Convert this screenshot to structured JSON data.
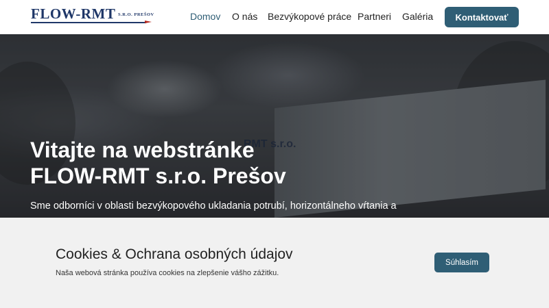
{
  "header": {
    "logo": {
      "name": "FLOW-RMT",
      "suffix": "S.R.O. PREŠOV"
    },
    "nav": [
      {
        "label": "Domov",
        "active": true
      },
      {
        "label": "O nás",
        "active": false
      },
      {
        "label": "Bezvýkopové práce",
        "active": false
      },
      {
        "label": "Partneri",
        "active": false
      },
      {
        "label": "Galéria",
        "active": false
      }
    ],
    "cta_label": "Kontaktovať"
  },
  "hero": {
    "title_line1": "Vitajte na webstránke",
    "title_line2": "FLOW-RMT s.r.o. Prešov",
    "text": "Sme odborníci v oblasti bezvýkopového ukladania potrubí, horizontálneho vŕtania a",
    "truck_label": "RMT s.r.o."
  },
  "cookie": {
    "title": "Cookies & Ochrana osobných údajov",
    "text": "Naša webová stránka používa cookies na zlepšenie vášho zážitku.",
    "accept_label": "Súhlasím"
  },
  "colors": {
    "accent": "#2f5e75",
    "brand": "#1f3768",
    "banner_bg": "#f1f1f1"
  }
}
